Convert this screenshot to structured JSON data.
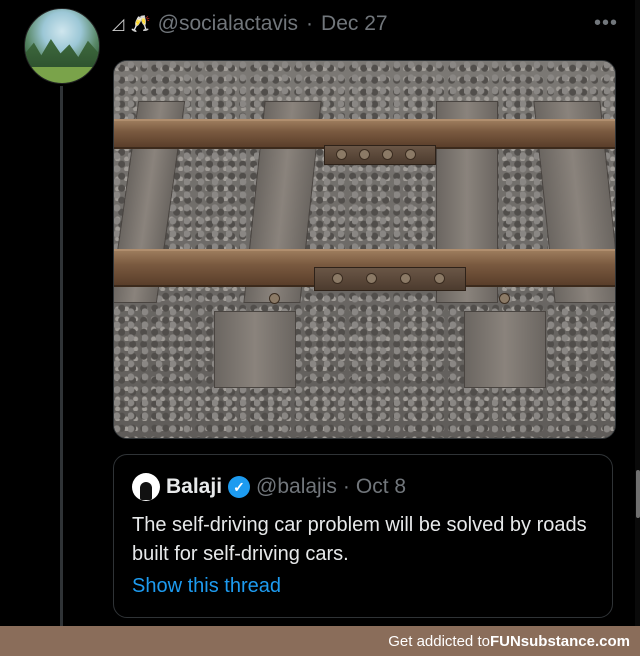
{
  "tweet": {
    "name_icons": "◿ 🥂",
    "handle": "@socialactavis",
    "separator": "·",
    "date": "Dec 27",
    "more_label": "•••"
  },
  "quote": {
    "name": "Balaji",
    "verified_mark": "✓",
    "handle": "@balajis",
    "separator": "·",
    "date": "Oct 8",
    "text": "The self-driving car problem will be solved by roads built for self-driving cars.",
    "show_thread": "Show this thread"
  },
  "footer": {
    "prefix": "Get addicted to ",
    "brand": "FUNsubstance.com"
  },
  "icons": {
    "more": "more-icon",
    "verified": "verified-badge-icon"
  },
  "colors": {
    "background": "#000000",
    "link": "#1d9bf0",
    "muted": "#71767b",
    "footer_bg": "#8a6d5a"
  }
}
